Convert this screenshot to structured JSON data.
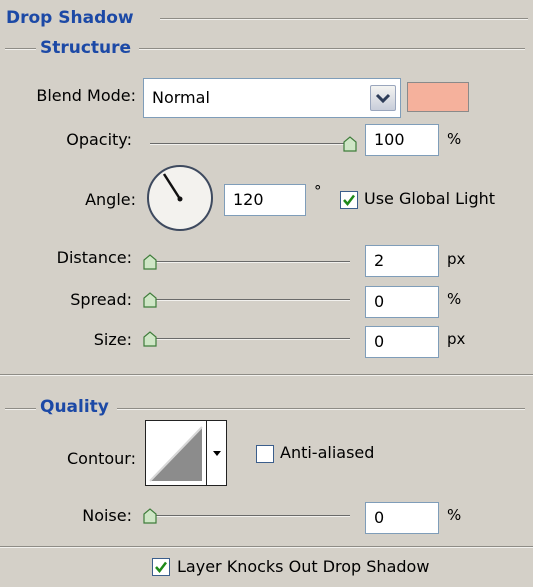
{
  "headers": {
    "panel_title": "Drop Shadow",
    "structure": "Structure",
    "quality": "Quality"
  },
  "structure": {
    "blend_mode_label": "Blend Mode:",
    "blend_mode_value": "Normal",
    "shadow_color": "#f5b19c",
    "opacity_label": "Opacity:",
    "opacity_value": "100",
    "opacity_unit": "%",
    "opacity_level": 1.0,
    "angle_label": "Angle:",
    "angle_value": "120",
    "angle_unit": "°",
    "use_global_light_label": "Use Global Light",
    "use_global_light_checked": true,
    "distance_label": "Distance:",
    "distance_value": "2",
    "distance_unit": "px",
    "distance_level": 0.0,
    "spread_label": "Spread:",
    "spread_value": "0",
    "spread_unit": "%",
    "spread_level": 0.0,
    "size_label": "Size:",
    "size_value": "0",
    "size_unit": "px",
    "size_level": 0.0
  },
  "quality": {
    "contour_label": "Contour:",
    "anti_aliased_label": "Anti-aliased",
    "anti_aliased_checked": false,
    "noise_label": "Noise:",
    "noise_value": "0",
    "noise_unit": "%",
    "noise_level": 0.0
  },
  "footer": {
    "layer_knocks_out_label": "Layer Knocks Out Drop Shadow",
    "layer_knocks_out_checked": true
  }
}
